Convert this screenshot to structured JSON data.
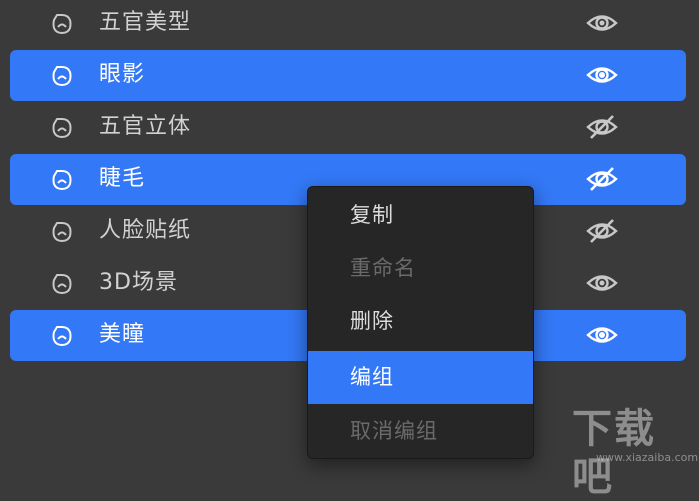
{
  "layers": [
    {
      "label": "五官美型",
      "selected": false,
      "icon": "face-mask-icon",
      "visibility": "visible"
    },
    {
      "label": "眼影",
      "selected": true,
      "icon": "face-mask-icon",
      "visibility": "visible"
    },
    {
      "label": "五官立体",
      "selected": false,
      "icon": "face-mask-icon",
      "visibility": "hidden"
    },
    {
      "label": "睫毛",
      "selected": true,
      "icon": "face-mask-icon",
      "visibility": "hidden"
    },
    {
      "label": "人脸贴纸",
      "selected": false,
      "icon": "face-mask-icon",
      "visibility": "hidden"
    },
    {
      "label": "3D场景",
      "selected": false,
      "icon": "face-mask-icon",
      "visibility": "visible"
    },
    {
      "label": "美瞳",
      "selected": true,
      "icon": "face-mask-icon",
      "visibility": "visible"
    }
  ],
  "context_menu": {
    "items": [
      {
        "label": "复制",
        "state": "enabled"
      },
      {
        "label": "重命名",
        "state": "disabled"
      },
      {
        "label": "删除",
        "state": "enabled"
      },
      {
        "label": "编组",
        "state": "highlighted"
      },
      {
        "label": "取消编组",
        "state": "disabled"
      }
    ]
  },
  "watermark": {
    "text": "下载吧",
    "url": "www.xiazaiba.com"
  },
  "colors": {
    "background": "#3a3a3a",
    "selection": "#3378f6",
    "menu_background": "#262626"
  }
}
